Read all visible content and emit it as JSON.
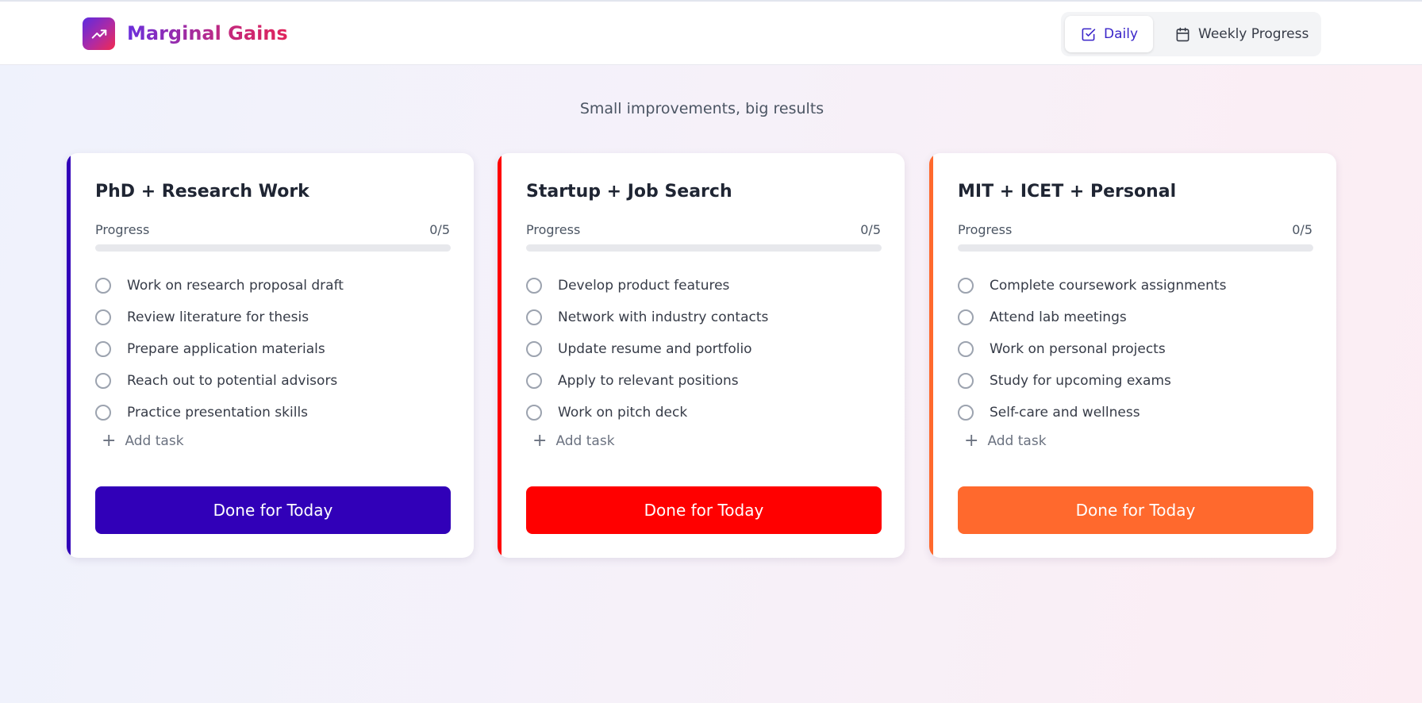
{
  "app": {
    "name": "Marginal Gains",
    "logo_icon": "trending-up-icon",
    "tagline": "Small improvements, big results"
  },
  "nav": {
    "tabs": [
      {
        "label": "Daily",
        "icon": "check-square-icon",
        "active": true
      },
      {
        "label": "Weekly Progress",
        "icon": "calendar-icon",
        "active": false
      }
    ]
  },
  "cards": [
    {
      "title": "PhD + Research Work",
      "color": "#3100b8",
      "progress_label": "Progress",
      "progress_text": "0/5",
      "progress_done": 0,
      "progress_total": 5,
      "tasks": [
        "Work on research proposal draft",
        "Review literature for thesis",
        "Prepare application materials",
        "Reach out to potential advisors",
        "Practice presentation skills"
      ],
      "add_task_label": "Add task",
      "done_label": "Done for Today"
    },
    {
      "title": "Startup + Job Search",
      "color": "#ff0000",
      "progress_label": "Progress",
      "progress_text": "0/5",
      "progress_done": 0,
      "progress_total": 5,
      "tasks": [
        "Develop product features",
        "Network with industry contacts",
        "Update resume and portfolio",
        "Apply to relevant positions",
        "Work on pitch deck"
      ],
      "add_task_label": "Add task",
      "done_label": "Done for Today"
    },
    {
      "title": "MIT + ICET + Personal",
      "color": "#ff692d",
      "progress_label": "Progress",
      "progress_text": "0/5",
      "progress_done": 0,
      "progress_total": 5,
      "tasks": [
        "Complete coursework assignments",
        "Attend lab meetings",
        "Work on personal projects",
        "Study for upcoming exams",
        "Self-care and wellness"
      ],
      "add_task_label": "Add task",
      "done_label": "Done for Today"
    }
  ]
}
